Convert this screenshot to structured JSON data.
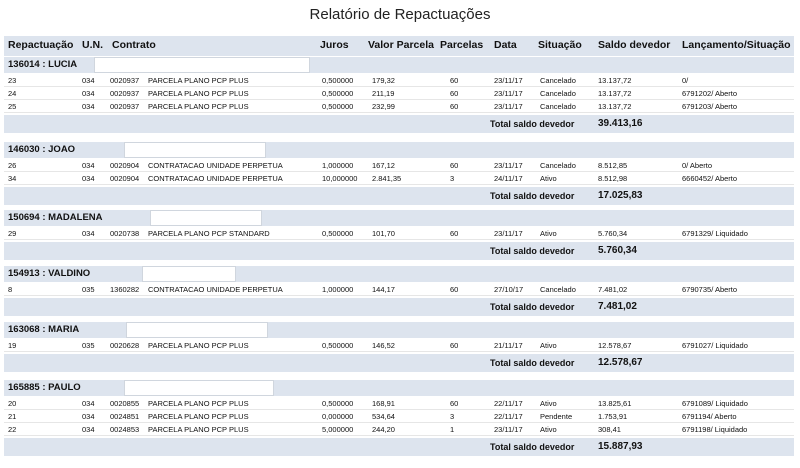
{
  "title": "Relatório de Repactuações",
  "columns": [
    "Repactuação",
    "U.N.",
    "Contrato",
    "Juros",
    "Valor Parcela",
    "Parcelas",
    "Data",
    "Situação",
    "Saldo devedor",
    "Lançamento/Situação"
  ],
  "total_label": "Total saldo devedor",
  "groups": [
    {
      "label": "136014 : LUCIA",
      "total": "39.413,16",
      "rows": [
        [
          "23",
          "034",
          "0020937",
          "PARCELA PLANO PCP PLUS",
          "0,500000",
          "179,32",
          "60",
          "23/11/17",
          "Cancelado",
          "13.137,72",
          "0/"
        ],
        [
          "24",
          "034",
          "0020937",
          "PARCELA PLANO PCP PLUS",
          "0,500000",
          "211,19",
          "60",
          "23/11/17",
          "Cancelado",
          "13.137,72",
          "6791202/ Aberto"
        ],
        [
          "25",
          "034",
          "0020937",
          "PARCELA PLANO PCP PLUS",
          "0,500000",
          "232,99",
          "60",
          "23/11/17",
          "Cancelado",
          "13.137,72",
          "6791203/ Aberto"
        ]
      ]
    },
    {
      "label": "146030 : JOAO",
      "total": "17.025,83",
      "rows": [
        [
          "26",
          "034",
          "0020904",
          "CONTRATACAO UNIDADE PERPETUA",
          "1,000000",
          "167,12",
          "60",
          "23/11/17",
          "Cancelado",
          "8.512,85",
          "0/ Aberto"
        ],
        [
          "34",
          "034",
          "0020904",
          "CONTRATACAO UNIDADE PERPETUA",
          "10,000000",
          "2.841,35",
          "3",
          "24/11/17",
          "Ativo",
          "8.512,98",
          "6660452/ Aberto"
        ]
      ]
    },
    {
      "label": "150694 : MADALENA",
      "total": "5.760,34",
      "rows": [
        [
          "29",
          "034",
          "0020738",
          "PARCELA PLANO PCP STANDARD",
          "0,500000",
          "101,70",
          "60",
          "23/11/17",
          "Ativo",
          "5.760,34",
          "6791329/ Liquidado"
        ]
      ]
    },
    {
      "label": "154913 : VALDINO",
      "total": "7.481,02",
      "rows": [
        [
          "8",
          "035",
          "1360282",
          "CONTRATACAO UNIDADE PERPETUA",
          "1,000000",
          "144,17",
          "60",
          "27/10/17",
          "Cancelado",
          "7.481,02",
          "6790735/ Aberto"
        ]
      ]
    },
    {
      "label": "163068 : MARIA",
      "total": "12.578,67",
      "rows": [
        [
          "19",
          "035",
          "0020628",
          "PARCELA PLANO PCP PLUS",
          "0,500000",
          "146,52",
          "60",
          "21/11/17",
          "Ativo",
          "12.578,67",
          "6791027/ Liquidado"
        ]
      ]
    },
    {
      "label": "165885 : PAULO",
      "total": "15.887,93",
      "rows": [
        [
          "20",
          "034",
          "0020855",
          "PARCELA PLANO PCP PLUS",
          "0,500000",
          "168,91",
          "60",
          "22/11/17",
          "Ativo",
          "13.825,61",
          "6791089/ Liquidado"
        ],
        [
          "21",
          "034",
          "0024851",
          "PARCELA PLANO PCP PLUS",
          "0,000000",
          "534,64",
          "3",
          "22/11/17",
          "Pendente",
          "1.753,91",
          "6791194/ Aberto"
        ],
        [
          "22",
          "034",
          "0024853",
          "PARCELA PLANO PCP PLUS",
          "5,000000",
          "244,20",
          "1",
          "23/11/17",
          "Ativo",
          "308,41",
          "6791198/ Liquidado"
        ]
      ]
    }
  ]
}
